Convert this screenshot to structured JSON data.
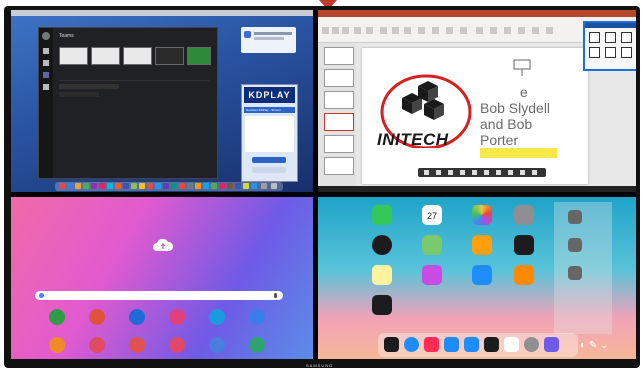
{
  "screen": {
    "brand_label": "SAMSUNG"
  },
  "q1": {
    "teams_title": "Teams",
    "tiles": [
      "",
      "",
      "",
      "",
      "",
      "",
      ""
    ],
    "kdplay_logo": "KDPLAY",
    "kdplay_header": "Receiver KDPlay - Screen"
  },
  "q2": {
    "slide_title_lines": [
      "Bob Slydell",
      "and Bob",
      "Porter"
    ],
    "slide_partial_letter": "e",
    "company_logo_text": "INITECH",
    "colors": {
      "ppt_brand": "#b7472a",
      "highlight": "#f7e84a",
      "ink": "#d42020"
    }
  },
  "q3": {
    "icons": [
      {
        "name": "phone",
        "color": "#2e9b46"
      },
      {
        "name": "contacts",
        "color": "#e05240"
      },
      {
        "name": "camera",
        "color": "#1e6ad8"
      },
      {
        "name": "gallery",
        "color": "#e0417d"
      },
      {
        "name": "play-store",
        "color": "#1a9ae0"
      },
      {
        "name": "chrome",
        "color": "#3b7de8"
      },
      {
        "name": "files",
        "color": "#f08a2a"
      },
      {
        "name": "flower",
        "color": "#e04b63"
      },
      {
        "name": "video",
        "color": "#e05252"
      },
      {
        "name": "email",
        "color": "#e0496a"
      },
      {
        "name": "internet",
        "color": "#4c7ce0"
      },
      {
        "name": "calendar",
        "color": "#2fa36f"
      }
    ]
  },
  "q4": {
    "calendar_day": "27",
    "apps": [
      {
        "name": "facetime",
        "color": "#35c759"
      },
      {
        "name": "calendar",
        "color": "#ffffff"
      },
      {
        "name": "photos",
        "color": "#ffffff"
      },
      {
        "name": "camera",
        "color": "#8e8e93"
      },
      {
        "name": "clock",
        "color": "#1c1c1e"
      },
      {
        "name": "maps",
        "color": "#7bc96f"
      },
      {
        "name": "home",
        "color": "#ff9f0a"
      },
      {
        "name": "tv",
        "color": "#1c1c1e"
      },
      {
        "name": "notes",
        "color": "#fff3a0"
      },
      {
        "name": "itunes-store",
        "color": "#c94be3"
      },
      {
        "name": "app-store",
        "color": "#1e8cff"
      },
      {
        "name": "books",
        "color": "#ff8a00"
      },
      {
        "name": "voice-memos",
        "color": "#1c1c1e"
      }
    ],
    "dock": [
      {
        "name": "phone",
        "color": "#1c1c1e"
      },
      {
        "name": "safari",
        "color": "#1e8cff"
      },
      {
        "name": "music",
        "color": "#ff2d55"
      },
      {
        "name": "mail",
        "color": "#1e8cff"
      },
      {
        "name": "files",
        "color": "#1e8cff"
      },
      {
        "name": "k-app",
        "color": "#1c1c1e"
      },
      {
        "name": "k-app-2",
        "color": "#ffffff"
      },
      {
        "name": "settings",
        "color": "#8e8e93"
      },
      {
        "name": "game",
        "color": "#6c5ce7"
      }
    ]
  }
}
